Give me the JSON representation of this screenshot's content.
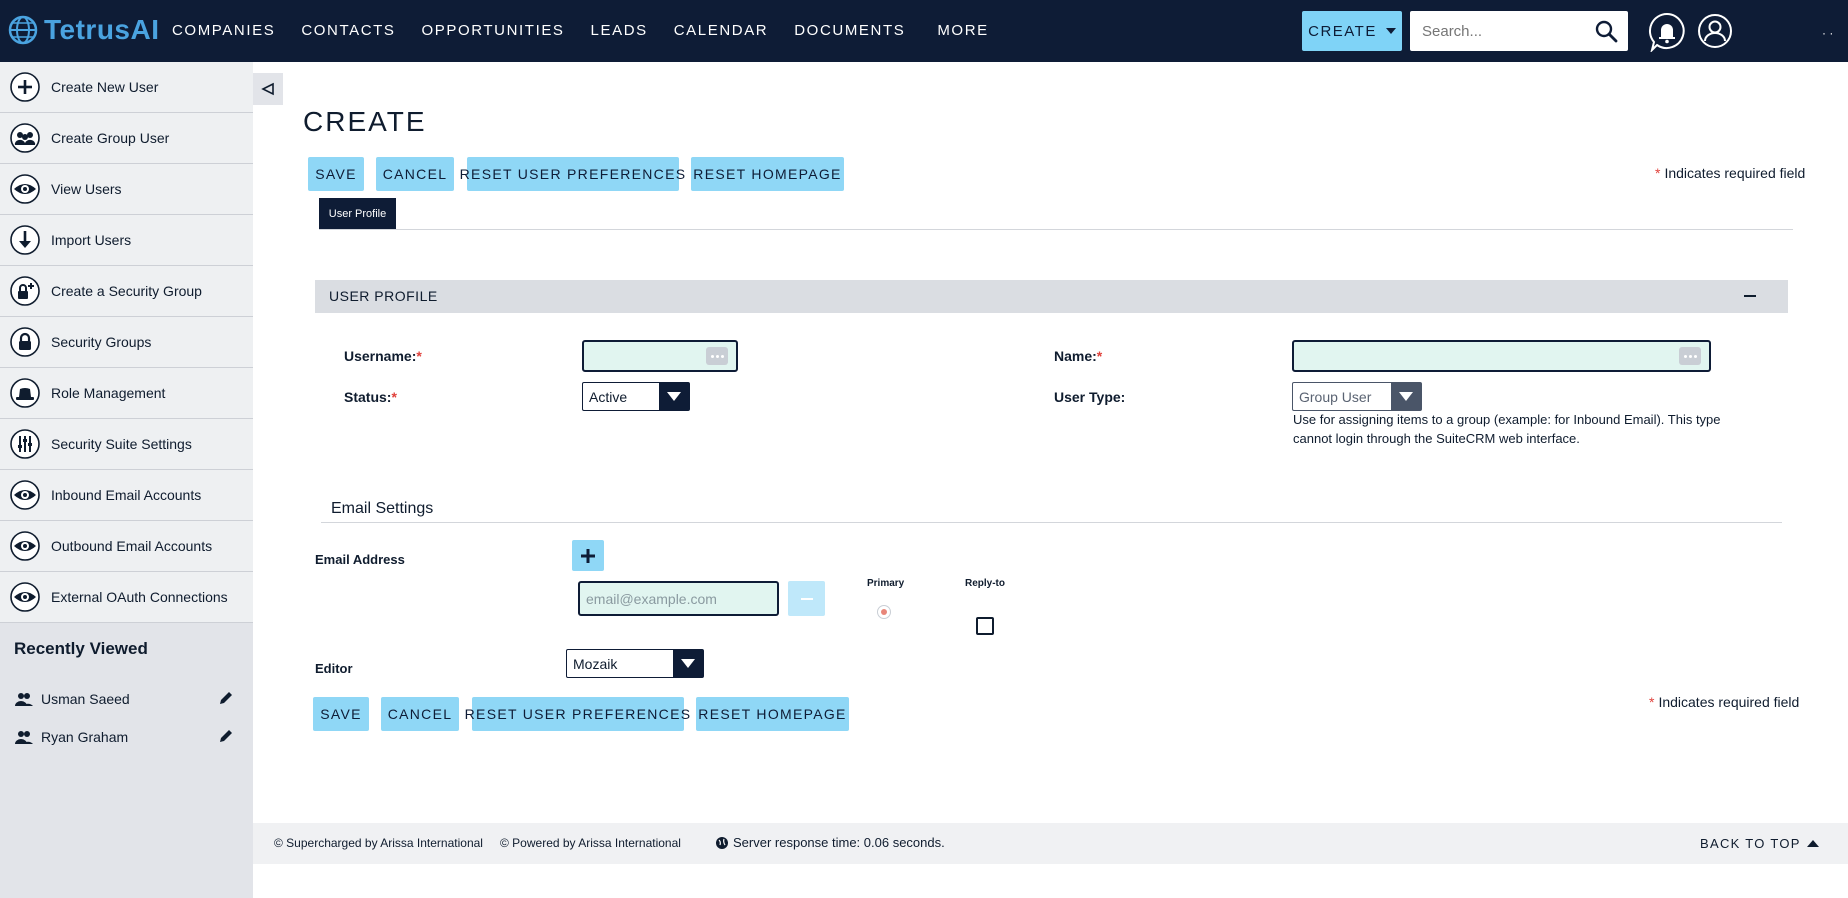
{
  "header": {
    "logo_text": "TetrusAI",
    "nav": [
      "COMPANIES",
      "CONTACTS",
      "OPPORTUNITIES",
      "LEADS",
      "CALENDAR",
      "DOCUMENTS",
      "MORE"
    ],
    "create_label": "CREATE",
    "search_placeholder": "Search...",
    "overflow": "· ·"
  },
  "sidebar": {
    "items": [
      {
        "label": "Create New User",
        "icon": "plus-circle-icon"
      },
      {
        "label": "Create Group User",
        "icon": "group-users-icon"
      },
      {
        "label": "View Users",
        "icon": "eye-icon"
      },
      {
        "label": "Import Users",
        "icon": "download-arrow-icon"
      },
      {
        "label": "Create a Security Group",
        "icon": "lock-plus-icon"
      },
      {
        "label": "Security Groups",
        "icon": "lock-icon"
      },
      {
        "label": "Role Management",
        "icon": "hat-icon"
      },
      {
        "label": "Security Suite Settings",
        "icon": "sliders-icon"
      },
      {
        "label": "Inbound Email Accounts",
        "icon": "eye-icon"
      },
      {
        "label": "Outbound Email Accounts",
        "icon": "eye-icon"
      },
      {
        "label": "External OAuth Connections",
        "icon": "eye-icon"
      }
    ],
    "recent_title": "Recently Viewed",
    "recent": [
      {
        "label": "Usman Saeed"
      },
      {
        "label": "Ryan Graham"
      }
    ]
  },
  "page": {
    "title": "CREATE",
    "buttons": {
      "save": "SAVE",
      "cancel": "CANCEL",
      "reset_prefs": "RESET USER PREFERENCES",
      "reset_home": "RESET HOMEPAGE"
    },
    "required_star": "*",
    "required_note": "Indicates required field",
    "tab": "User Profile",
    "panel_title": "USER PROFILE",
    "fields": {
      "username_label": "Username:",
      "name_label": "Name:",
      "status_label": "Status:",
      "status_value": "Active",
      "user_type_label": "User Type:",
      "user_type_value": "Group User",
      "user_type_help": "Use for assigning items to a group (example: for Inbound Email). This type cannot login through the SuiteCRM web interface."
    },
    "email": {
      "section_title": "Email Settings",
      "address_label": "Email Address",
      "placeholder": "email@example.com",
      "primary_label": "Primary",
      "replyto_label": "Reply-to"
    },
    "editor": {
      "label": "Editor",
      "value": "Mozaik"
    }
  },
  "footer": {
    "supercharged": "© Supercharged by Arissa International",
    "powered": "© Powered by Arissa International",
    "server_time": "Server response time: 0.06 seconds.",
    "back_to_top": "BACK TO TOP"
  }
}
